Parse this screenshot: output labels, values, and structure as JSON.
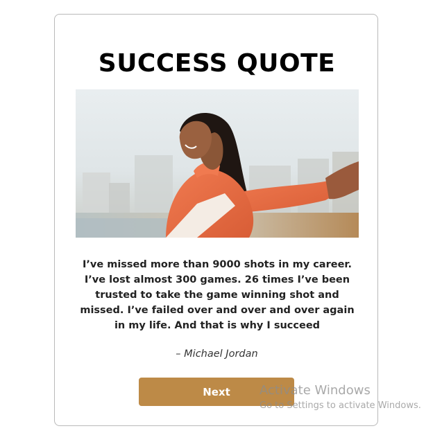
{
  "card": {
    "title": "SUCCESS QUOTE",
    "quote": "I’ve missed more than 9000 shots in my career. I’ve lost almost 300 games. 26 times I’ve been trusted to take the game winning shot and missed. I’ve failed over and over and over again in my life. And that is why I succeed",
    "author": "– Michael Jordan",
    "next_label": "Next",
    "accent_color": "#bd8a47"
  },
  "watermark": {
    "title": "Activate Windows",
    "subtitle": "Go to Settings to activate Windows."
  }
}
